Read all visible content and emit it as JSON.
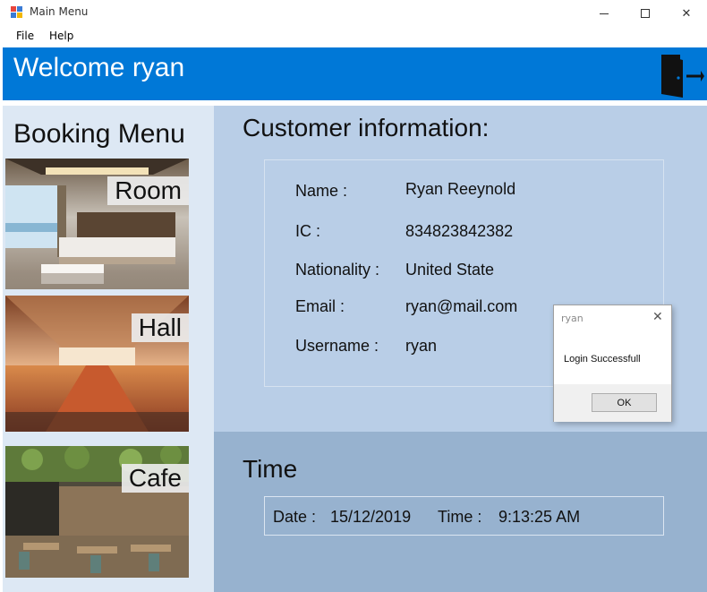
{
  "window": {
    "title": "Main Menu",
    "minimize_glyph": "—",
    "maximize_glyph": "☐",
    "close_glyph": "✕"
  },
  "menu": {
    "items": [
      {
        "label": "File"
      },
      {
        "label": "Help"
      }
    ]
  },
  "header": {
    "welcome_text": "Welcome ryan",
    "bg_color": "#0078d7",
    "exit_icon": "exit-door-icon"
  },
  "sidebar": {
    "title": "Booking Menu",
    "tiles": [
      {
        "label": "Room"
      },
      {
        "label": "Hall"
      },
      {
        "label": "Cafe"
      }
    ]
  },
  "customer": {
    "heading": "Customer information:",
    "fields": [
      {
        "label": "Name :",
        "value": "Ryan Reeynold"
      },
      {
        "label": "IC :",
        "value": "834823842382"
      },
      {
        "label": "Nationality :",
        "value": "United State"
      },
      {
        "label": "Email :",
        "value": "ryan@mail.com"
      },
      {
        "label": "Username :",
        "value": "ryan"
      }
    ]
  },
  "time": {
    "heading": "Time",
    "date_label": "Date :",
    "date_value": "15/12/2019",
    "time_label": "Time :",
    "time_value": "9:13:25 AM"
  },
  "dialog": {
    "title": "ryan",
    "close_glyph": "✕",
    "message": "Login Successfull",
    "ok_label": "OK"
  }
}
